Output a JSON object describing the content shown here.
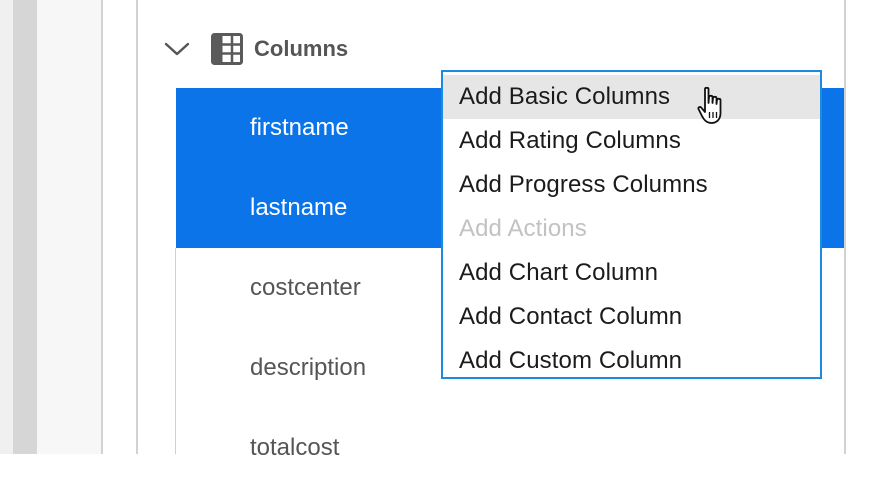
{
  "section": {
    "title": "Columns",
    "chevron_icon": "chevron-down-icon",
    "section_icon": "grid-icon"
  },
  "rows": [
    {
      "label": "firstname",
      "selected": true
    },
    {
      "label": "lastname",
      "selected": true
    },
    {
      "label": "costcenter",
      "selected": false
    },
    {
      "label": "description",
      "selected": false
    },
    {
      "label": "totalcost",
      "selected": false
    }
  ],
  "menu": {
    "items": [
      {
        "label": "Add Basic Columns",
        "state": "hovered"
      },
      {
        "label": "Add Rating Columns",
        "state": "enabled"
      },
      {
        "label": "Add Progress Columns",
        "state": "enabled"
      },
      {
        "label": "Add Actions",
        "state": "disabled"
      },
      {
        "label": "Add Chart Column",
        "state": "enabled"
      },
      {
        "label": "Add Contact Column",
        "state": "enabled"
      },
      {
        "label": "Add Custom Column",
        "state": "enabled"
      }
    ]
  },
  "colors": {
    "selection": "#0a74e8",
    "menu_border": "#1a8be0",
    "menu_hover": "#e6e6e6",
    "disabled_text": "#c2c2c2"
  },
  "cursor_icon": "hand-pointer-icon"
}
